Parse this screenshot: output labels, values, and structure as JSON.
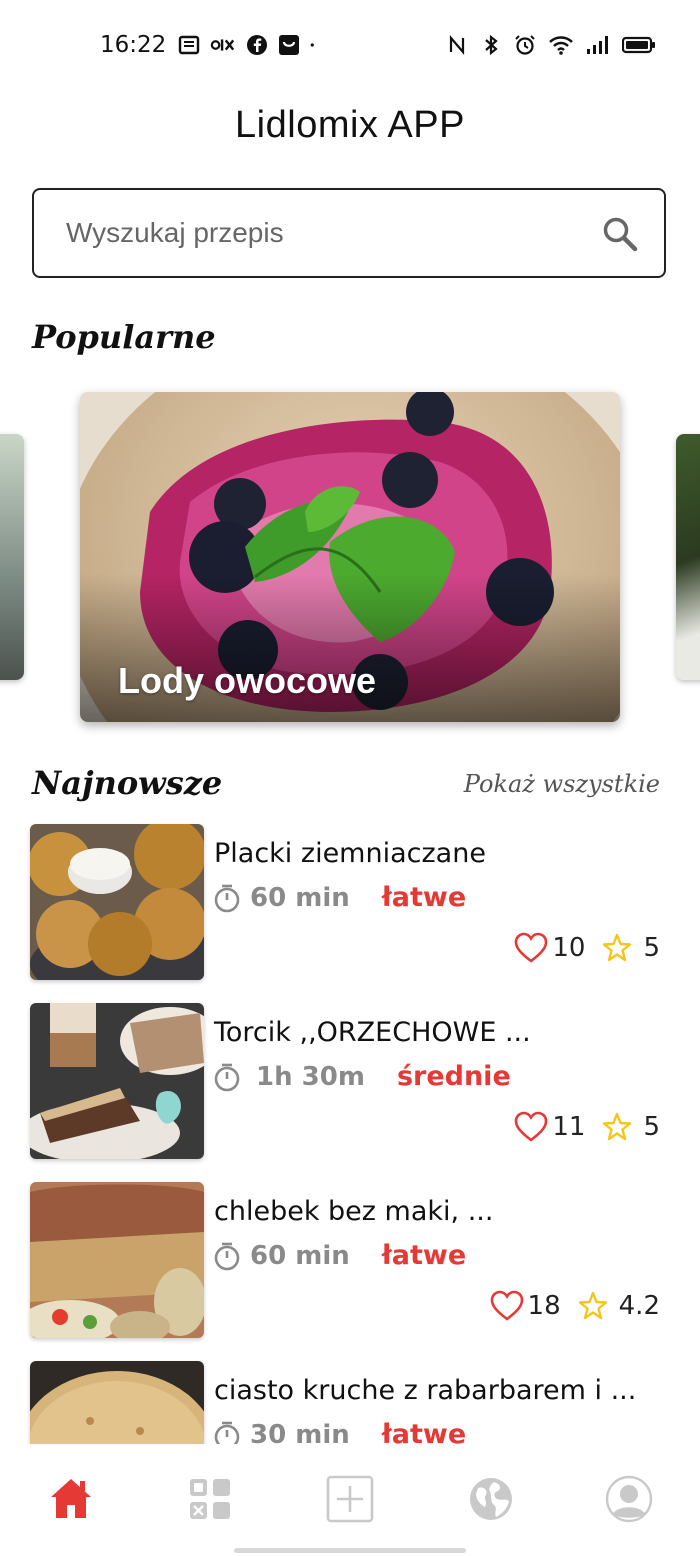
{
  "status_bar": {
    "time": "16:22"
  },
  "header": {
    "title": "Lidlomix APP"
  },
  "search": {
    "placeholder": "Wyszukaj przepis"
  },
  "popular": {
    "title": "Popularne",
    "featured": {
      "label": "Lody owocowe"
    }
  },
  "newest": {
    "title": "Najnowsze",
    "show_all": "Pokaż wszystkie",
    "items": [
      {
        "title": "Placki ziemniaczane",
        "time": "60 min",
        "difficulty": "łatwe",
        "likes": "10",
        "rating": "5"
      },
      {
        "title": "Torcik ,,ORZECHOWE ...",
        "time": "1h 30m",
        "difficulty": "średnie",
        "likes": "11",
        "rating": "5"
      },
      {
        "title": "chlebek bez maki, ...",
        "time": "60 min",
        "difficulty": "łatwe",
        "likes": "18",
        "rating": "4.2"
      },
      {
        "title": "ciasto kruche z rabarbarem i ...",
        "time": "30 min",
        "difficulty": "łatwe",
        "likes": "",
        "rating": ""
      }
    ]
  },
  "nav": {
    "items": [
      "home-icon",
      "categories-icon",
      "add-recipe-icon",
      "globe-icon",
      "profile-icon"
    ],
    "active": "home-icon"
  },
  "colors": {
    "accent": "#e53935",
    "star": "#f5c518",
    "muted": "#8a8a8a"
  }
}
